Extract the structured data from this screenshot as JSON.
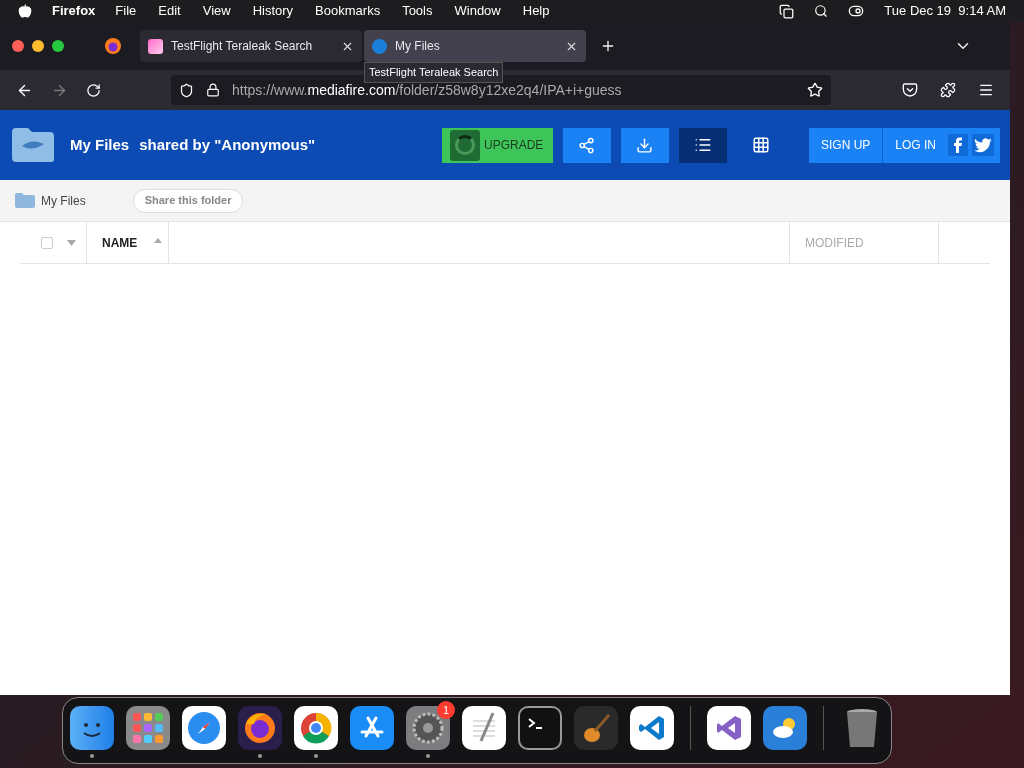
{
  "menu_bar": {
    "app": "Firefox",
    "items": [
      "File",
      "Edit",
      "View",
      "History",
      "Bookmarks",
      "Tools",
      "Window",
      "Help"
    ],
    "clock": "Tue Dec 19  9:14 AM"
  },
  "tabs": [
    {
      "title": "TestFlight Teraleak Search",
      "selected": false
    },
    {
      "title": "My Files",
      "selected": true
    }
  ],
  "tooltip": "TestFlight Teraleak Search",
  "address": {
    "prefix": "https://www.",
    "domain": "mediafire.com",
    "path": "/folder/z58w8y12xe2q4/IPA+i+guess"
  },
  "header": {
    "title": "My Files",
    "shared_by": "shared by \"Anonymous\"",
    "upgrade": "UPGRADE",
    "view_buttons": [
      {
        "kind": "list",
        "selected": true
      },
      {
        "kind": "grid",
        "selected": false
      }
    ],
    "sign_up": "SIGN UP",
    "log_in": "LOG IN"
  },
  "breadcrumb": {
    "folder": "My Files",
    "share": "Share this folder"
  },
  "table": {
    "columns": [
      "NAME",
      "MODIFIED"
    ],
    "select_all": false
  },
  "dock": [
    {
      "kind": "finder",
      "running": true
    },
    {
      "kind": "launchpad",
      "running": false
    },
    {
      "kind": "safari",
      "running": false
    },
    {
      "kind": "firefox",
      "running": true
    },
    {
      "kind": "chrome",
      "running": true
    },
    {
      "kind": "appstore",
      "running": false
    },
    {
      "kind": "settings",
      "running": true,
      "badge": "1"
    },
    {
      "kind": "textedit",
      "running": false
    },
    {
      "kind": "terminal",
      "running": false
    },
    {
      "kind": "garageband",
      "running": false
    },
    {
      "kind": "vscode",
      "running": false
    },
    {
      "kind": "separator"
    },
    {
      "kind": "visualstudio",
      "running": false
    },
    {
      "kind": "weather",
      "running": false
    },
    {
      "kind": "separator"
    },
    {
      "kind": "trash",
      "running": false
    }
  ]
}
